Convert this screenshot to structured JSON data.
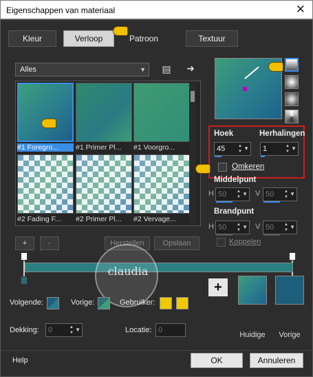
{
  "window": {
    "title": "Eigenschappen van materiaal"
  },
  "tabs": [
    {
      "label": "Kleur"
    },
    {
      "label": "Verloop"
    },
    {
      "label": "Patroon"
    },
    {
      "label": "Textuur"
    }
  ],
  "filter": {
    "selected": "Alles"
  },
  "gallery": {
    "items": [
      {
        "label": "#1 Foregro..."
      },
      {
        "label": "#1 Primer Pl..."
      },
      {
        "label": "#1 Voorgro..."
      },
      {
        "label": "#2 Fading F..."
      },
      {
        "label": "#2 Primer Pl..."
      },
      {
        "label": "#2 Vervage..."
      }
    ]
  },
  "settings": {
    "hoek_label": "Hoek",
    "hoek_value": "45",
    "herhalingen_label": "Herhalingen",
    "herhalingen_value": "1",
    "omkeren_label": "Omkeren",
    "middelpunt_label": "Middelpunt",
    "brandpunt_label": "Brandpunt",
    "h_label": "H",
    "v_label": "V",
    "middel_h": "50",
    "middel_v": "50",
    "brand_h": "50",
    "brand_v": "50",
    "koppelen_label": "Koppelen"
  },
  "ramp": {
    "add": "+",
    "remove": "-",
    "reset": "Herstellen",
    "save": "Opslaan"
  },
  "watermark": {
    "text": "claudia"
  },
  "bottom": {
    "volgende_label": "Volgende:",
    "vorige_label": "Vorige:",
    "gebruiker_label": "Gebruiker:",
    "dekking_label": "Dekking:",
    "dekking_value": "0",
    "locatie_label": "Locatie:",
    "locatie_value": "0",
    "huidige_label": "Huidige",
    "vorige_swatch_label": "Vorige",
    "plus_label": "+"
  },
  "footer": {
    "help": "Help",
    "ok": "OK",
    "cancel": "Annuleren"
  },
  "colors": {
    "accent": "#3a8ee8",
    "teal": "#1d5f7a",
    "green": "#3d9c79",
    "yellow": "#f0c800",
    "red_box": "#cc1e1e"
  }
}
